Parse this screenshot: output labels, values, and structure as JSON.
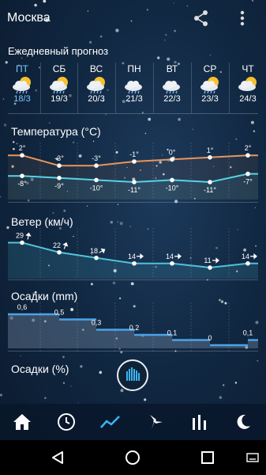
{
  "header": {
    "title": "Москва"
  },
  "daily": {
    "title": "Ежедневный прогноз",
    "days": [
      {
        "name": "ПТ",
        "date": "18/3",
        "icon": "sun-cloud-rain-icon"
      },
      {
        "name": "СБ",
        "date": "19/3",
        "icon": "sun-cloud-rain-icon"
      },
      {
        "name": "ВС",
        "date": "20/3",
        "icon": "sun-cloud-rain-icon"
      },
      {
        "name": "ПН",
        "date": "21/3",
        "icon": "cloud-rain-icon"
      },
      {
        "name": "ВТ",
        "date": "22/3",
        "icon": "cloud-rain-icon"
      },
      {
        "name": "СР",
        "date": "23/3",
        "icon": "sun-cloud-rain-icon"
      },
      {
        "name": "ЧТ",
        "date": "24/3",
        "icon": "sun-cloud-icon"
      }
    ]
  },
  "temperature": {
    "title": "Температура (°C)",
    "high": [
      "2°",
      "-3°",
      "-3°",
      "-1°",
      "0°",
      "1°",
      "2°"
    ],
    "low": [
      "-8°",
      "-9°",
      "-10°",
      "-11°",
      "-10°",
      "-11°",
      "-7°"
    ],
    "high_values": [
      2,
      -3,
      -3,
      -1,
      0,
      1,
      2
    ],
    "low_values": [
      -8,
      -9,
      -10,
      -11,
      -10,
      -11,
      -7
    ],
    "high_color": "#e8955a",
    "low_color": "#56d3e6"
  },
  "wind": {
    "title": "Ветер (км/ч)",
    "labels": [
      "29",
      "22",
      "18",
      "14",
      "14",
      "11",
      "14"
    ],
    "values": [
      29,
      22,
      18,
      14,
      14,
      11,
      14
    ],
    "color": "#4fc3d8"
  },
  "precip": {
    "title": "Осадки (mm)",
    "labels": [
      "0,6",
      "0,5",
      "0,3",
      "0,2",
      "0,1",
      "0",
      "0,1"
    ],
    "values": [
      0.6,
      0.5,
      0.3,
      0.2,
      0.1,
      0,
      0.1
    ],
    "color": "#4aa3e8"
  },
  "precip_pct": {
    "title": "Осадки (%)"
  },
  "colors": {
    "accent": "#3ab4f2"
  }
}
